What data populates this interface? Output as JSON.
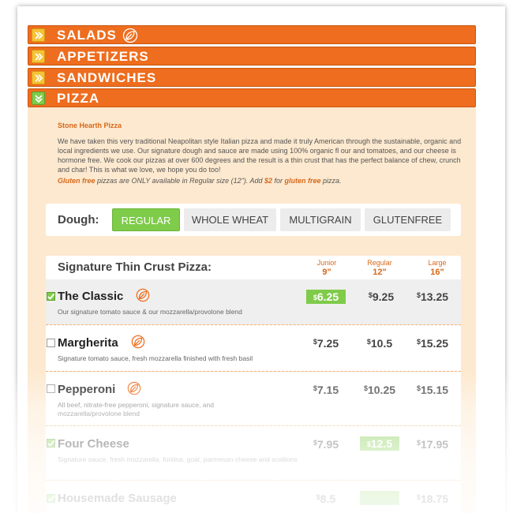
{
  "categories": [
    {
      "label": "SALADS",
      "expanded": false,
      "icon": "leaf-icon"
    },
    {
      "label": "APPETIZERS",
      "expanded": false
    },
    {
      "label": "SANDWICHES",
      "expanded": false
    },
    {
      "label": "PIZZA",
      "expanded": true
    }
  ],
  "pizza": {
    "intro_title": "Stone Hearth Pizza",
    "intro_text": "We have taken this very traditional Neapolitan style Italian pizza and made it truly American through the sustainable, organic and local ingredients we use. Our signature dough and sauce are made using 100% organic fl our and tomatoes, and our cheese is hormone free. We cook our pizzas at over 600 degrees and the result is a thin crust that has the perfect balance of chew, crunch and char! This is what we love, we hope you do too!",
    "gf_note": {
      "part1": "Gluten free",
      "part2": " pizzas are ONLY available in Regular size (12\"). Add ",
      "part3": "$2",
      "part4": " for ",
      "part5": "gluten free",
      "part6": " pizza."
    },
    "dough": {
      "label": "Dough:",
      "options": [
        "REGULAR",
        "WHOLE WHEAT",
        "MULTIGRAIN",
        "GLUTENFREE"
      ],
      "selected": "REGULAR"
    },
    "section_title": "Signature Thin Crust Pizza:",
    "sizes": [
      {
        "name": "Junior",
        "inches": "9\""
      },
      {
        "name": "Regular",
        "inches": "12\""
      },
      {
        "name": "Large",
        "inches": "16\""
      }
    ],
    "currency": "$",
    "items": [
      {
        "name": "The Classic",
        "desc": "Our signature tomato sauce & our mozzarella/provolone blend",
        "checked": true,
        "prices": [
          "6.25",
          "9.25",
          "13.25"
        ],
        "highlight": 0
      },
      {
        "name": "Margherita",
        "desc": "Signature tomato sauce, fresh mozzarella finished with fresh basil",
        "checked": false,
        "prices": [
          "7.25",
          "10.5",
          "15.25"
        ]
      },
      {
        "name": "Pepperoni",
        "desc": "All beef, nitrate-free pepperoni, signature sauce, and mozzarella/provolone blend",
        "checked": false,
        "prices": [
          "7.15",
          "10.25",
          "15.15"
        ]
      },
      {
        "name": "Four Cheese",
        "desc": "Signature sauce, fresh mozzarella, fontina, goat, parmesan cheese and scallions",
        "checked": true,
        "prices": [
          "7.95",
          "12.5",
          "17.95"
        ],
        "highlight": 1
      },
      {
        "name": "Housemade Sausage",
        "desc": "",
        "checked": true,
        "prices": [
          "8.5",
          "",
          "18.75"
        ],
        "highlight": 1
      }
    ]
  },
  "colors": {
    "accent": "#ee6d1e",
    "green": "#7fcb4a",
    "panel": "#fde9cf"
  }
}
